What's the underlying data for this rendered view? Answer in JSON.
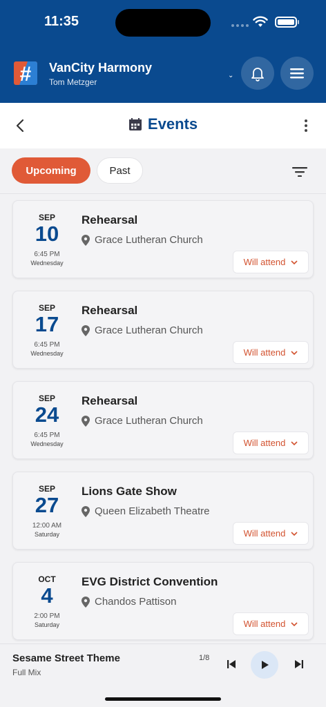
{
  "status": {
    "time": "11:35"
  },
  "header": {
    "app_name": "VanCity Harmony",
    "user_name": "Tom Metzger",
    "logo_icon": "hash-logo",
    "brand_color": "#0a4a8f"
  },
  "titlebar": {
    "title": "Events",
    "title_icon": "calendar-icon"
  },
  "tabs": {
    "upcoming": "Upcoming",
    "past": "Past",
    "active": "Upcoming",
    "accent": "#e05a37"
  },
  "events": [
    {
      "month": "SEP",
      "day": "10",
      "time": "6:45 PM",
      "weekday": "Wednesday",
      "title": "Rehearsal",
      "location": "Grace Lutheran Church",
      "rsvp": "Will attend"
    },
    {
      "month": "SEP",
      "day": "17",
      "time": "6:45 PM",
      "weekday": "Wednesday",
      "title": "Rehearsal",
      "location": "Grace Lutheran Church",
      "rsvp": "Will attend"
    },
    {
      "month": "SEP",
      "day": "24",
      "time": "6:45 PM",
      "weekday": "Wednesday",
      "title": "Rehearsal",
      "location": "Grace Lutheran Church",
      "rsvp": "Will attend"
    },
    {
      "month": "SEP",
      "day": "27",
      "time": "12:00 AM",
      "weekday": "Saturday",
      "title": "Lions Gate Show",
      "location": "Queen Elizabeth Theatre",
      "rsvp": "Will attend"
    },
    {
      "month": "OCT",
      "day": "4",
      "time": "2:00 PM",
      "weekday": "Saturday",
      "title": "EVG District Convention",
      "location": "Chandos Pattison",
      "rsvp": "Will attend"
    }
  ],
  "player": {
    "track": "Sesame Street Theme",
    "mix": "Full Mix",
    "position": "1/8"
  }
}
